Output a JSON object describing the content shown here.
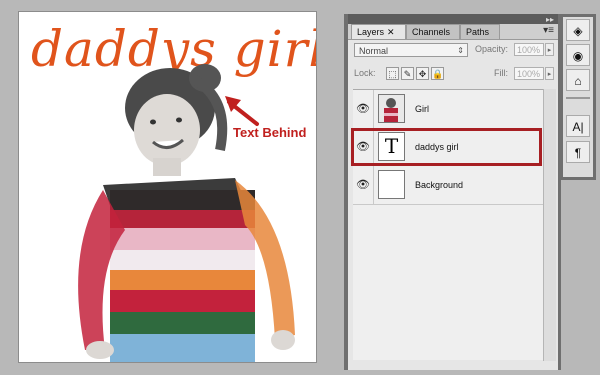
{
  "canvas": {
    "title_text": "daddys girl",
    "annotation": "Text Behind"
  },
  "panel": {
    "tabs": [
      {
        "label": "Layers",
        "close": "✕"
      },
      {
        "label": "Channels"
      },
      {
        "label": "Paths"
      }
    ],
    "collapse_glyph": "▸▸",
    "menu_glyph": "▾≡",
    "blend_mode": "Normal",
    "blend_arrows": "⇕",
    "opacity_label": "Opacity:",
    "opacity_value": "100%",
    "lock_label": "Lock:",
    "fill_label": "Fill:",
    "fill_value": "100%",
    "step_glyph": "▸",
    "lock_icons": [
      "⬚",
      "✎",
      "✥",
      "🔒"
    ],
    "layers": [
      {
        "name": "Girl",
        "visible": true,
        "eye": "👁",
        "type": "image"
      },
      {
        "name": "daddys girl",
        "visible": true,
        "eye": "👁",
        "type": "text",
        "thumb_glyph": "T"
      },
      {
        "name": "Background",
        "visible": true,
        "eye": "👁",
        "type": "fill"
      }
    ]
  },
  "dock": {
    "buttons": [
      "◈",
      "◉",
      "⌂",
      "A|",
      "¶"
    ]
  },
  "colors": {
    "title": "#e0541c",
    "annotation": "#c0201e",
    "highlight": "#a71f23"
  }
}
